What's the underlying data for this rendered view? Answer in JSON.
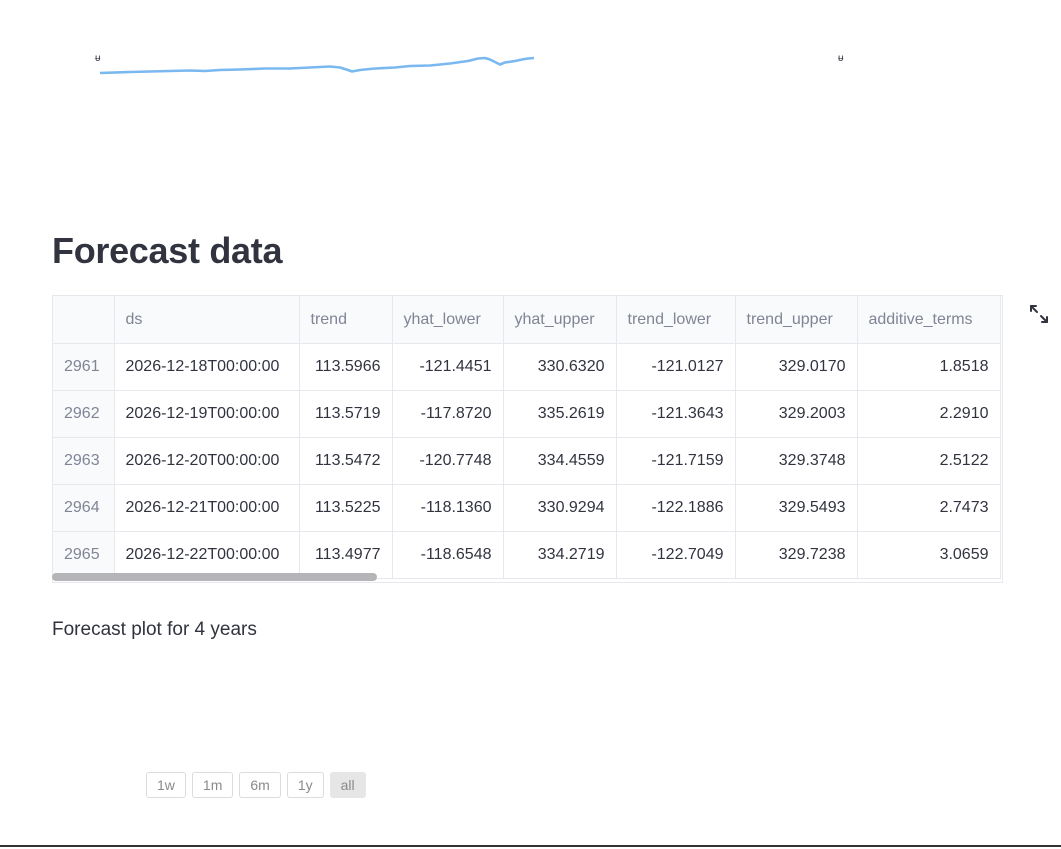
{
  "mini_chart": {
    "tick_left": "ᵾ",
    "tick_right": "ᵾ",
    "line_color": "#7ab8f0"
  },
  "forecast_section": {
    "title": "Forecast data"
  },
  "table": {
    "columns": [
      "",
      "ds",
      "trend",
      "yhat_lower",
      "yhat_upper",
      "trend_lower",
      "trend_upper",
      "additive_terms"
    ],
    "rows": [
      [
        "2961",
        "2026-12-18T00:00:00",
        "113.5966",
        "-121.4451",
        "330.6320",
        "-121.0127",
        "329.0170",
        "1.8518"
      ],
      [
        "2962",
        "2026-12-19T00:00:00",
        "113.5719",
        "-117.8720",
        "335.2619",
        "-121.3643",
        "329.2003",
        "2.2910"
      ],
      [
        "2963",
        "2026-12-20T00:00:00",
        "113.5472",
        "-120.7748",
        "334.4559",
        "-121.7159",
        "329.3748",
        "2.5122"
      ],
      [
        "2964",
        "2026-12-21T00:00:00",
        "113.5225",
        "-118.1360",
        "330.9294",
        "-122.1886",
        "329.5493",
        "2.7473"
      ],
      [
        "2965",
        "2026-12-22T00:00:00",
        "113.4977",
        "-118.6548",
        "334.2719",
        "-122.7049",
        "329.7238",
        "3.0659"
      ]
    ]
  },
  "plot_section": {
    "subtitle": "Forecast plot for 4 years"
  },
  "range_selector": {
    "buttons": [
      "1w",
      "1m",
      "6m",
      "1y",
      "all"
    ],
    "active": "all"
  }
}
